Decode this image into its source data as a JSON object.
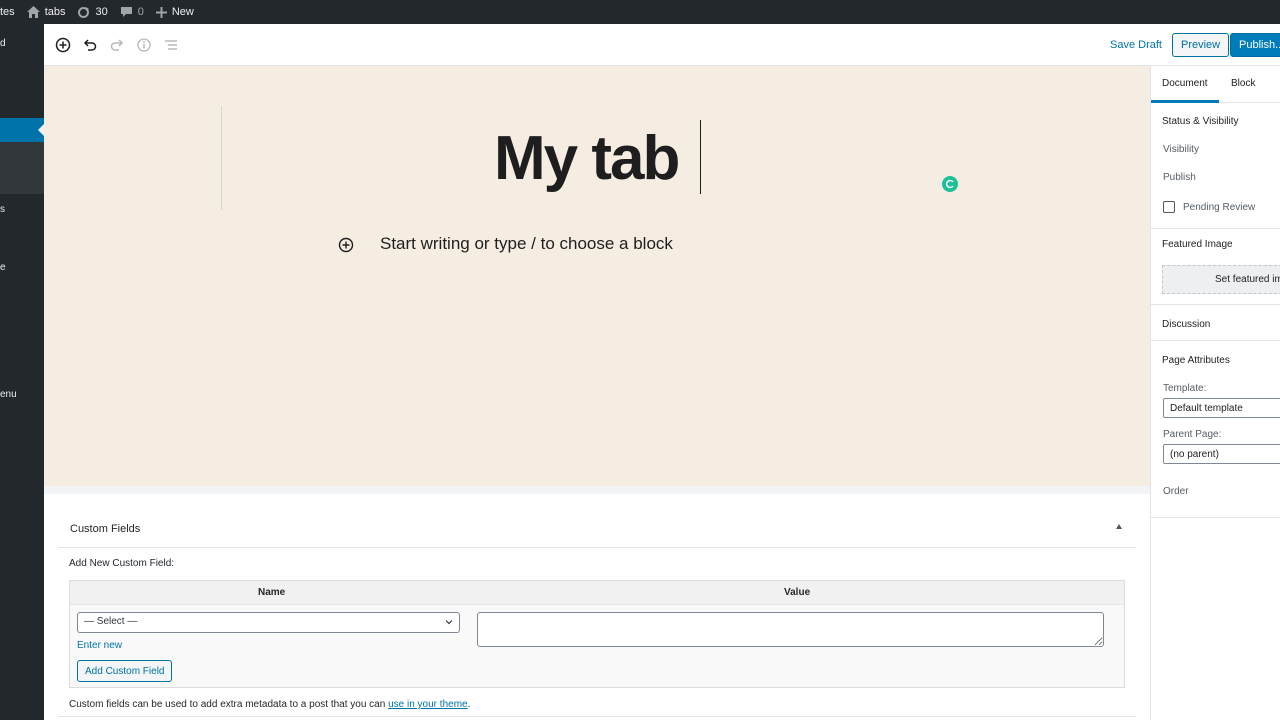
{
  "admin_bar": {
    "sites_fragment": "tes",
    "site_name": "tabs",
    "updates_count": "30",
    "comments_count": "0",
    "new_label": "New"
  },
  "admin_menu": {
    "fragments": [
      "d",
      "s",
      "e",
      "enu"
    ]
  },
  "toolbar": {
    "save_draft_label": "Save Draft",
    "preview_label": "Preview",
    "publish_label": "Publish..."
  },
  "editor": {
    "title": "My tab",
    "block_placeholder": "Start writing or type / to choose a block"
  },
  "custom_fields": {
    "title": "Custom Fields",
    "add_new_label": "Add New Custom Field:",
    "col_name": "Name",
    "col_value": "Value",
    "select_value": "— Select —",
    "enter_new_label": "Enter new",
    "add_button_label": "Add Custom Field",
    "note_prefix": "Custom fields can be used to add extra metadata to a post that you can ",
    "note_link": "use in your theme",
    "note_suffix": "."
  },
  "sidebar": {
    "tab_document": "Document",
    "tab_block": "Block",
    "status_visibility": "Status & Visibility",
    "visibility_label": "Visibility",
    "publish_label": "Publish",
    "pending_review_label": "Pending Review",
    "featured_image": "Featured Image",
    "set_featured_label": "Set featured im",
    "discussion": "Discussion",
    "page_attributes": "Page Attributes",
    "template_label": "Template:",
    "template_value": "Default template",
    "parent_label": "Parent Page:",
    "parent_value": "(no parent)",
    "order_label": "Order"
  },
  "colors": {
    "accent": "#007cba",
    "admin_bg": "#23282d",
    "canvas_bg": "#f5ede1",
    "spinner": "#1ac199"
  }
}
